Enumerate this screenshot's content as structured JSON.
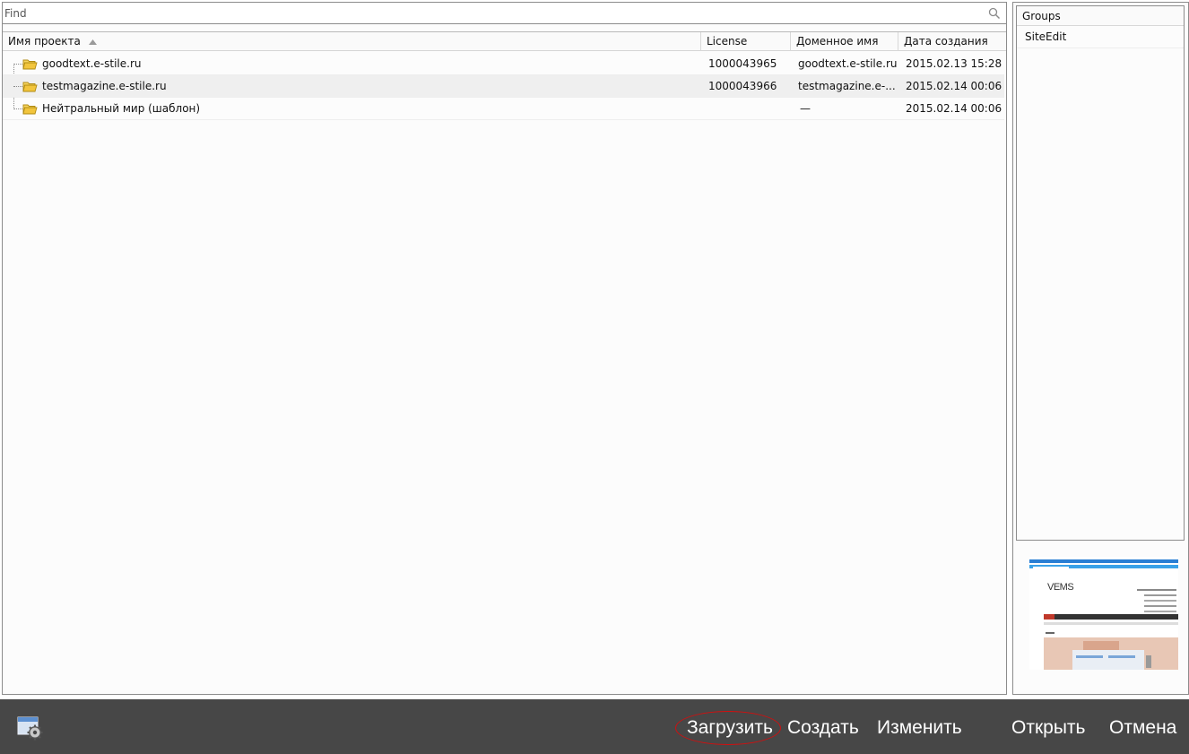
{
  "search": {
    "placeholder": "Find"
  },
  "table": {
    "columns": [
      "Имя проекта",
      "License",
      "Доменное имя",
      "Дата создания"
    ],
    "rows": [
      {
        "name": "goodtext.e-stile.ru",
        "license": "1000043965",
        "domain": "goodtext.e-stile.ru",
        "created": "2015.02.13 15:28"
      },
      {
        "name": "testmagazine.e-stile.ru",
        "license": "1000043966",
        "domain": "testmagazine.e-...",
        "created": "2015.02.14 00:06"
      },
      {
        "name": "Нейтральный мир (шаблон)",
        "license": "",
        "domain": "—",
        "created": "2015.02.14 00:06"
      }
    ]
  },
  "groups": {
    "header": "Groups",
    "items": [
      "SiteEdit"
    ]
  },
  "preview": {
    "logo_text": "VEMS"
  },
  "actions": {
    "load": "Загрузить",
    "create": "Создать",
    "edit": "Изменить",
    "open": "Открыть",
    "cancel": "Отмена"
  },
  "colors": {
    "bottom_bar": "#474747",
    "highlight": "#d01010",
    "folder": "#f2c53d",
    "selected_row": "#efefef"
  },
  "icons": [
    "search-icon",
    "sort-ascending-icon",
    "folder-icon",
    "settings-window-icon"
  ]
}
